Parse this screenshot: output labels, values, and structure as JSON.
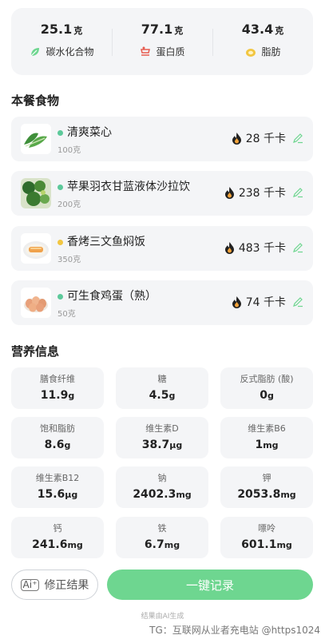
{
  "macros": [
    {
      "value": "25.1",
      "unit": "克",
      "label": "碳水化合物",
      "icon": "leaf-icon",
      "color": "#6ed690"
    },
    {
      "value": "77.1",
      "unit": "克",
      "label": "蛋白质",
      "icon": "steak-icon",
      "color": "#e65b4f"
    },
    {
      "value": "43.4",
      "unit": "克",
      "label": "脂肪",
      "icon": "oil-icon",
      "color": "#f2c641"
    }
  ],
  "meal_section_title": "本餐食物",
  "foods": [
    {
      "name": "清爽菜心",
      "weight": "100克",
      "calories": "28 千卡",
      "dot_color": "#5cc99a"
    },
    {
      "name": "苹果羽衣甘蓝液体沙拉饮",
      "weight": "200克",
      "calories": "238 千卡",
      "dot_color": "#5cc99a"
    },
    {
      "name": "香烤三文鱼焖饭",
      "weight": "350克",
      "calories": "483 千卡",
      "dot_color": "#f2c641"
    },
    {
      "name": "可生食鸡蛋（熟）",
      "weight": "50克",
      "calories": "74 千卡",
      "dot_color": "#5cc99a"
    }
  ],
  "nutrition_section_title": "营养信息",
  "nutrition": [
    {
      "label": "膳食纤维",
      "value": "11.9",
      "unit": "g"
    },
    {
      "label": "糖",
      "value": "4.5",
      "unit": "g"
    },
    {
      "label": "反式脂肪 (酸)",
      "value": "0",
      "unit": "g"
    },
    {
      "label": "饱和脂肪",
      "value": "8.6",
      "unit": "g"
    },
    {
      "label": "维生素D",
      "value": "38.7",
      "unit": "μg"
    },
    {
      "label": "维生素B6",
      "value": "1",
      "unit": "mg"
    },
    {
      "label": "维生素B12",
      "value": "15.6",
      "unit": "μg"
    },
    {
      "label": "钠",
      "value": "2402.3",
      "unit": "mg"
    },
    {
      "label": "钾",
      "value": "2053.8",
      "unit": "mg"
    },
    {
      "label": "钙",
      "value": "241.6",
      "unit": "mg"
    },
    {
      "label": "铁",
      "value": "6.7",
      "unit": "mg"
    },
    {
      "label": "嘌呤",
      "value": "601.1",
      "unit": "mg"
    }
  ],
  "buttons": {
    "fix_icon": "Ai⁺",
    "fix_label": "修正结果",
    "record_label": "一键记录"
  },
  "footnote": "结果由AI生成",
  "watermark": "TG：互联网从业者充电站 @https1024",
  "colors": {
    "accent_green": "#6ed690",
    "card_bg": "#f4f5f7"
  }
}
